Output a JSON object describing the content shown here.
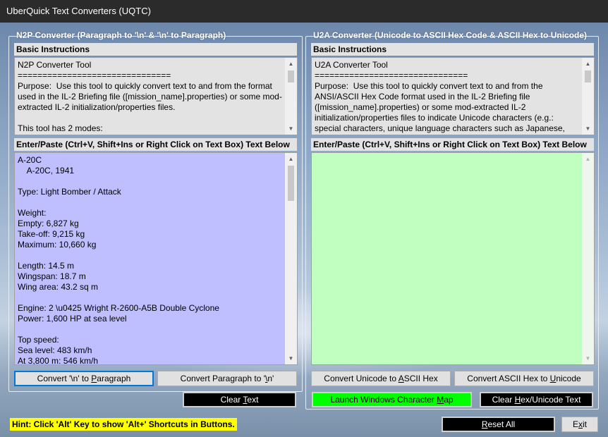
{
  "window": {
    "title": "UberQuick Text Converters (UQTC)"
  },
  "n2p": {
    "group_title": "N2P Converter (Paragraph to '\\n' & '\\n' to Paragraph)",
    "instructions_label": "Basic Instructions",
    "instructions_text": "N2P Converter Tool\n===============================\nPurpose:  Use this tool to quickly convert text to and from the format used in the IL-2 Briefing file ([mission_name].properties) or some mod-extracted IL-2 initialization/properties files.\n\nThis tool has 2 modes:",
    "input_label": "Enter/Paste (Ctrl+V, Shift+Ins or Right Click on Text Box) Text Below",
    "input_lines": [
      "A-20C",
      "    A-20C, 1941",
      "",
      "Type: Light Bomber / Attack",
      "",
      "Weight:",
      "Empty: 6,827 kg",
      "Take-off: 9,215 kg",
      "Maximum: 10,660 kg",
      "",
      "Length: 14.5 m",
      "Wingspan: 18.7 m",
      "Wing area: 43.2 sq m",
      "",
      "Engine: 2 \\u0425 Wright R-2600-A5B Double Cyclone",
      "Power: 1,600 HP at sea level",
      "",
      "Top speed:",
      "Sea level: 483 km/h",
      "At 3,800 m: 546 km/h"
    ],
    "btn_to_paragraph": {
      "pre": "Convert '\\n' to ",
      "key": "P",
      "post": "aragraph"
    },
    "btn_to_n": {
      "pre": "Convert Paragraph to '",
      "key": "\\",
      "post": "n'"
    },
    "btn_clear": {
      "pre": "Clear ",
      "key": "T",
      "post": "ext"
    }
  },
  "u2a": {
    "group_title": "U2A Converter (Unicode to ASCII Hex Code & ASCII Hex to Unicode)",
    "instructions_label": "Basic Instructions",
    "instructions_text": "U2A Converter Tool\n===============================\nPurpose:  Use this tool to quickly convert text to and from the ANSI/ASCII Hex Code format used in the IL-2 Briefing file ([mission_name].properties) or some mod-extracted IL-2 initialization/properties files to indicate Unicode characters (e.g.: special characters, unique language characters such as Japanese,",
    "input_label": "Enter/Paste (Ctrl+V, Shift+Ins or Right Click on Text Box) Text Below",
    "btn_to_hex": {
      "pre": "Convert Unicode to ",
      "key": "A",
      "post": "SCII Hex"
    },
    "btn_to_unicode": {
      "pre": "Convert ASCII Hex to ",
      "key": "U",
      "post": "nicode"
    },
    "btn_charmap": {
      "pre": "Launch Windows Character ",
      "key": "M",
      "post": "ap"
    },
    "btn_clear": {
      "pre": "Clear ",
      "key": "H",
      "post": "ex/Unicode Text"
    }
  },
  "footer": {
    "hint": "Hint:  Click 'Alt' Key to show 'Alt+' Shortcuts in Buttons.",
    "btn_reset": {
      "pre": "",
      "key": "R",
      "post": "eset All"
    },
    "btn_exit": {
      "pre": "E",
      "key": "x",
      "post": "it"
    }
  },
  "colors": {
    "titlebar": "#2b2b2b",
    "n2p_input_bg": "#bfbfff",
    "u2a_input_bg": "#c0ffc0",
    "hint_bg": "#ffff00",
    "charmap_bg": "#00ff00",
    "focus_border": "#0078d7"
  }
}
